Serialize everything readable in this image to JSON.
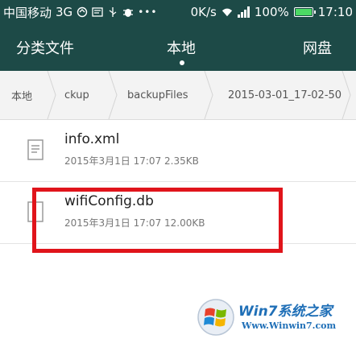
{
  "status_bar": {
    "carrier": "中国移动",
    "network": "3G",
    "speed": "0K/s",
    "battery_percent": "100%",
    "battery_level": 1.0,
    "time": "17:10",
    "icons": [
      "sync-icon",
      "message-icon",
      "usb-icon",
      "bug-icon",
      "more-dots-icon",
      "wifi-icon",
      "signal-icon",
      "battery-icon"
    ],
    "background_color": "#1d4a47"
  },
  "tabs": {
    "categories": "分类文件",
    "local": "本地",
    "cloud": "网盘",
    "active": "local"
  },
  "breadcrumb": {
    "items": [
      "本地",
      "ckup",
      "backupFiles",
      "2015-03-01_17-02-50"
    ]
  },
  "files": [
    {
      "name": "info.xml",
      "meta": "2015年3月1日 17:07 2.35KB",
      "icon": "document-icon"
    },
    {
      "name": "wifiConfig.db",
      "meta": "2015年3月1日 17:07 12.00KB",
      "icon": "database-file-icon",
      "highlighted": true
    }
  ],
  "highlight_color": "#e0141b",
  "watermark": {
    "brand": "Win7系统之家",
    "url": "Www.Winwin7.com"
  }
}
